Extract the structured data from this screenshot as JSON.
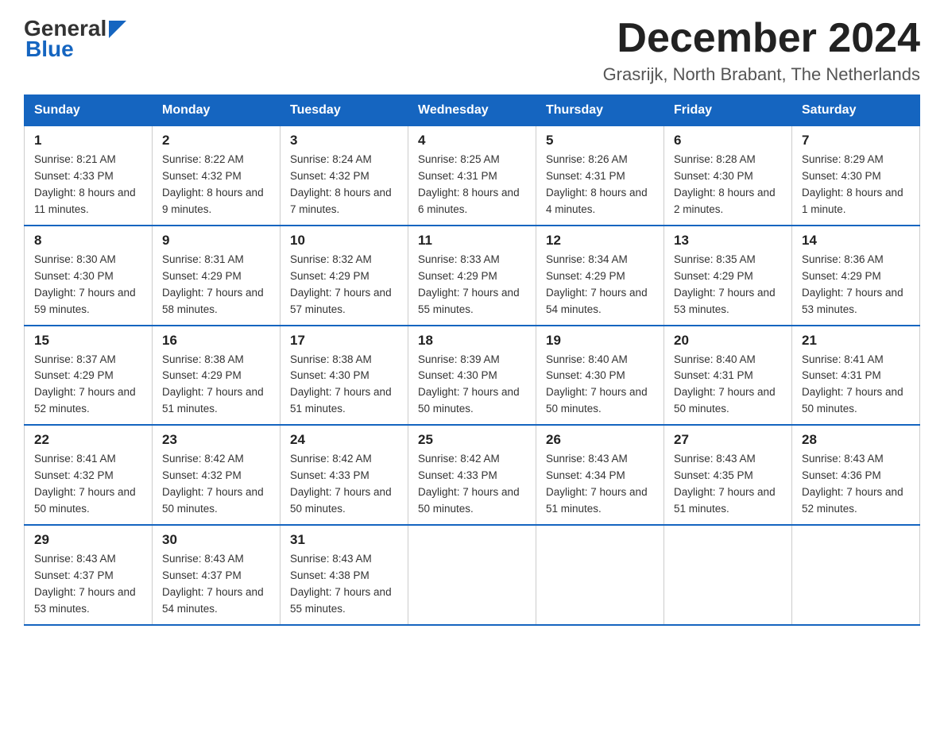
{
  "logo": {
    "general": "General",
    "blue": "Blue",
    "arrow_char": "▶"
  },
  "header": {
    "month_year": "December 2024",
    "location": "Grasrijk, North Brabant, The Netherlands"
  },
  "weekdays": [
    "Sunday",
    "Monday",
    "Tuesday",
    "Wednesday",
    "Thursday",
    "Friday",
    "Saturday"
  ],
  "weeks": [
    [
      {
        "day": "1",
        "sunrise": "8:21 AM",
        "sunset": "4:33 PM",
        "daylight": "8 hours and 11 minutes."
      },
      {
        "day": "2",
        "sunrise": "8:22 AM",
        "sunset": "4:32 PM",
        "daylight": "8 hours and 9 minutes."
      },
      {
        "day": "3",
        "sunrise": "8:24 AM",
        "sunset": "4:32 PM",
        "daylight": "8 hours and 7 minutes."
      },
      {
        "day": "4",
        "sunrise": "8:25 AM",
        "sunset": "4:31 PM",
        "daylight": "8 hours and 6 minutes."
      },
      {
        "day": "5",
        "sunrise": "8:26 AM",
        "sunset": "4:31 PM",
        "daylight": "8 hours and 4 minutes."
      },
      {
        "day": "6",
        "sunrise": "8:28 AM",
        "sunset": "4:30 PM",
        "daylight": "8 hours and 2 minutes."
      },
      {
        "day": "7",
        "sunrise": "8:29 AM",
        "sunset": "4:30 PM",
        "daylight": "8 hours and 1 minute."
      }
    ],
    [
      {
        "day": "8",
        "sunrise": "8:30 AM",
        "sunset": "4:30 PM",
        "daylight": "7 hours and 59 minutes."
      },
      {
        "day": "9",
        "sunrise": "8:31 AM",
        "sunset": "4:29 PM",
        "daylight": "7 hours and 58 minutes."
      },
      {
        "day": "10",
        "sunrise": "8:32 AM",
        "sunset": "4:29 PM",
        "daylight": "7 hours and 57 minutes."
      },
      {
        "day": "11",
        "sunrise": "8:33 AM",
        "sunset": "4:29 PM",
        "daylight": "7 hours and 55 minutes."
      },
      {
        "day": "12",
        "sunrise": "8:34 AM",
        "sunset": "4:29 PM",
        "daylight": "7 hours and 54 minutes."
      },
      {
        "day": "13",
        "sunrise": "8:35 AM",
        "sunset": "4:29 PM",
        "daylight": "7 hours and 53 minutes."
      },
      {
        "day": "14",
        "sunrise": "8:36 AM",
        "sunset": "4:29 PM",
        "daylight": "7 hours and 53 minutes."
      }
    ],
    [
      {
        "day": "15",
        "sunrise": "8:37 AM",
        "sunset": "4:29 PM",
        "daylight": "7 hours and 52 minutes."
      },
      {
        "day": "16",
        "sunrise": "8:38 AM",
        "sunset": "4:29 PM",
        "daylight": "7 hours and 51 minutes."
      },
      {
        "day": "17",
        "sunrise": "8:38 AM",
        "sunset": "4:30 PM",
        "daylight": "7 hours and 51 minutes."
      },
      {
        "day": "18",
        "sunrise": "8:39 AM",
        "sunset": "4:30 PM",
        "daylight": "7 hours and 50 minutes."
      },
      {
        "day": "19",
        "sunrise": "8:40 AM",
        "sunset": "4:30 PM",
        "daylight": "7 hours and 50 minutes."
      },
      {
        "day": "20",
        "sunrise": "8:40 AM",
        "sunset": "4:31 PM",
        "daylight": "7 hours and 50 minutes."
      },
      {
        "day": "21",
        "sunrise": "8:41 AM",
        "sunset": "4:31 PM",
        "daylight": "7 hours and 50 minutes."
      }
    ],
    [
      {
        "day": "22",
        "sunrise": "8:41 AM",
        "sunset": "4:32 PM",
        "daylight": "7 hours and 50 minutes."
      },
      {
        "day": "23",
        "sunrise": "8:42 AM",
        "sunset": "4:32 PM",
        "daylight": "7 hours and 50 minutes."
      },
      {
        "day": "24",
        "sunrise": "8:42 AM",
        "sunset": "4:33 PM",
        "daylight": "7 hours and 50 minutes."
      },
      {
        "day": "25",
        "sunrise": "8:42 AM",
        "sunset": "4:33 PM",
        "daylight": "7 hours and 50 minutes."
      },
      {
        "day": "26",
        "sunrise": "8:43 AM",
        "sunset": "4:34 PM",
        "daylight": "7 hours and 51 minutes."
      },
      {
        "day": "27",
        "sunrise": "8:43 AM",
        "sunset": "4:35 PM",
        "daylight": "7 hours and 51 minutes."
      },
      {
        "day": "28",
        "sunrise": "8:43 AM",
        "sunset": "4:36 PM",
        "daylight": "7 hours and 52 minutes."
      }
    ],
    [
      {
        "day": "29",
        "sunrise": "8:43 AM",
        "sunset": "4:37 PM",
        "daylight": "7 hours and 53 minutes."
      },
      {
        "day": "30",
        "sunrise": "8:43 AM",
        "sunset": "4:37 PM",
        "daylight": "7 hours and 54 minutes."
      },
      {
        "day": "31",
        "sunrise": "8:43 AM",
        "sunset": "4:38 PM",
        "daylight": "7 hours and 55 minutes."
      },
      null,
      null,
      null,
      null
    ]
  ],
  "labels": {
    "sunrise": "Sunrise:",
    "sunset": "Sunset:",
    "daylight": "Daylight:"
  }
}
